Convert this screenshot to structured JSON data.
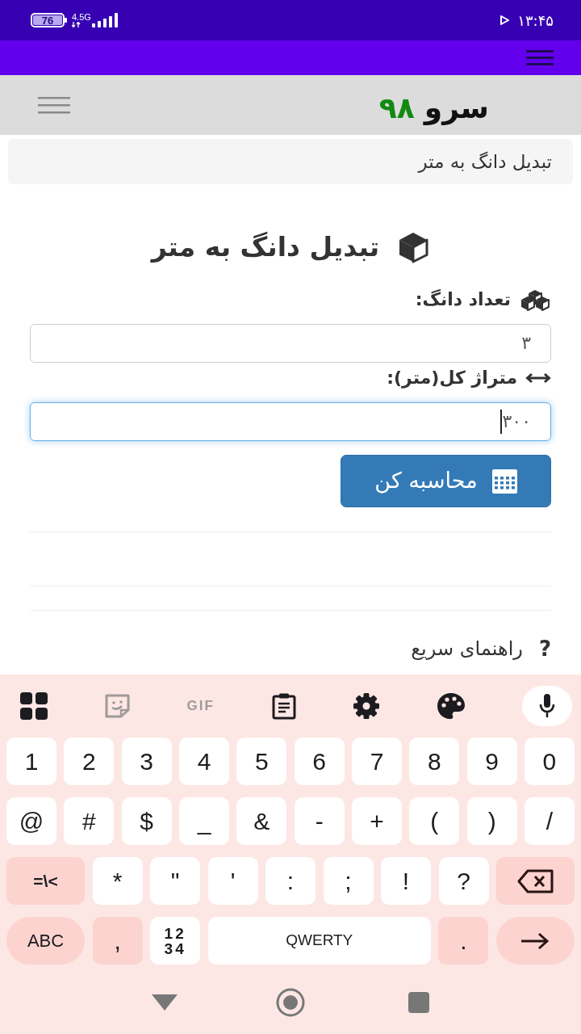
{
  "status_bar": {
    "battery": "76",
    "network": "4.5G",
    "time": "۱۳:۴۵"
  },
  "site_header": {
    "logo": {
      "name": "سرو",
      "number": "۹۸"
    }
  },
  "breadcrumb": "تبدیل دانگ به متر",
  "calculator": {
    "title": "تبدیل دانگ به متر",
    "fields": [
      {
        "kind": "count",
        "label": "تعداد دانگ:",
        "value": "۳",
        "focused": false
      },
      {
        "kind": "area",
        "label": "متراژ کل(متر):",
        "value": "۳۰۰",
        "focused": true
      }
    ],
    "button": "محاسبه کن"
  },
  "help": {
    "icon": "?",
    "title": "راهنمای سریع"
  },
  "keyboard": {
    "toolbar_label": "GIF",
    "rows": [
      {
        "keys": [
          {
            "kind": "char",
            "label": "0"
          },
          {
            "kind": "char",
            "label": "9"
          },
          {
            "kind": "char",
            "label": "8"
          },
          {
            "kind": "char",
            "label": "7"
          },
          {
            "kind": "char",
            "label": "6"
          },
          {
            "kind": "char",
            "label": "5"
          },
          {
            "kind": "char",
            "label": "4"
          },
          {
            "kind": "char",
            "label": "3"
          },
          {
            "kind": "char",
            "label": "2"
          },
          {
            "kind": "char",
            "label": "1"
          }
        ]
      },
      {
        "keys": [
          {
            "kind": "char",
            "label": "/"
          },
          {
            "kind": "char",
            "label": ")"
          },
          {
            "kind": "char",
            "label": "("
          },
          {
            "kind": "char",
            "label": "+"
          },
          {
            "kind": "char",
            "label": "-"
          },
          {
            "kind": "char",
            "label": "&"
          },
          {
            "kind": "char",
            "label": "_"
          },
          {
            "kind": "char",
            "label": "$"
          },
          {
            "kind": "char",
            "label": "#"
          },
          {
            "kind": "char",
            "label": "@"
          }
        ]
      },
      {
        "keys": [
          {
            "kind": "backspace"
          },
          {
            "kind": "char",
            "label": "?"
          },
          {
            "kind": "char",
            "label": "!"
          },
          {
            "kind": "char",
            "label": ";"
          },
          {
            "kind": "char",
            "label": ":"
          },
          {
            "kind": "char",
            "label": "'"
          },
          {
            "kind": "char",
            "label": "\""
          },
          {
            "kind": "char",
            "label": "*"
          },
          {
            "kind": "switch",
            "label": "=\\<"
          }
        ]
      },
      {
        "keys": [
          {
            "kind": "enter"
          },
          {
            "kind": "alt",
            "label": "."
          },
          {
            "kind": "space",
            "label": "QWERTY"
          },
          {
            "kind": "numpad",
            "lines": [
              "12",
              "34"
            ]
          },
          {
            "kind": "alt",
            "label": ","
          },
          {
            "kind": "mode",
            "label": "ABC"
          }
        ]
      }
    ]
  }
}
